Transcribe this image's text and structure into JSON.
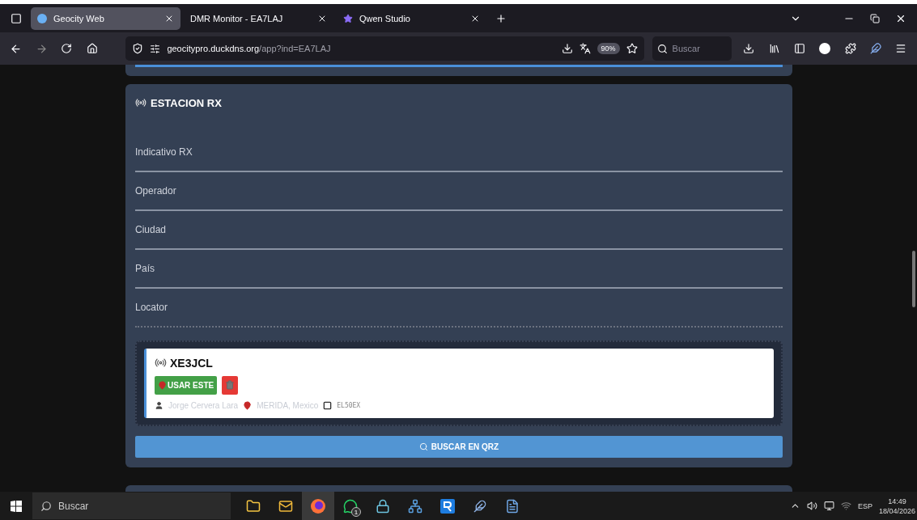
{
  "browser": {
    "tabs": [
      {
        "title": "Geocity Web",
        "selected": true
      },
      {
        "title": "DMR Monitor - EA7LAJ",
        "selected": false
      },
      {
        "title": "Qwen Studio",
        "selected": false
      }
    ],
    "address": {
      "host": "geocitypro.duckdns.org",
      "path": "/app?ind=EA7LAJ"
    },
    "zoom": "90%",
    "search": {
      "placeholder": "Buscar"
    }
  },
  "section": {
    "title": "ESTACION RX",
    "fields": [
      {
        "label": "Indicativo RX",
        "kind": "solid"
      },
      {
        "label": "Operador",
        "kind": "solid"
      },
      {
        "label": "Ciudad",
        "kind": "solid"
      },
      {
        "label": "País",
        "kind": "solid"
      },
      {
        "label": "Locator",
        "kind": "dotted"
      }
    ],
    "result": {
      "callsign": "XE3JCL",
      "use_button": "USAR ESTE",
      "name": "Jorge Cervera Lara",
      "location": "MERIDA, Mexico",
      "locator": "EL50EX"
    },
    "search_button": "BUSCAR EN QRZ"
  },
  "taskbar": {
    "search": {
      "placeholder": "Buscar"
    },
    "apps": [
      {
        "kind": "folder",
        "selected": false
      },
      {
        "kind": "mail",
        "selected": false
      },
      {
        "kind": "firefox",
        "selected": true
      },
      {
        "kind": "whatsapp",
        "selected": false,
        "badge": "1"
      },
      {
        "kind": "lock",
        "selected": false
      },
      {
        "kind": "network",
        "selected": false
      },
      {
        "kind": "r",
        "selected": false
      },
      {
        "kind": "pen",
        "selected": false
      },
      {
        "kind": "doc",
        "selected": false
      }
    ],
    "language": "ESP",
    "time": "14:49",
    "date": "18/04/2026"
  }
}
